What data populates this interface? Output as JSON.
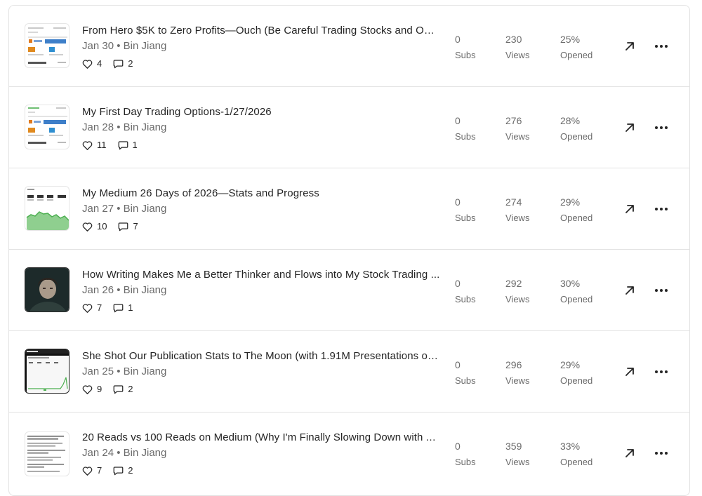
{
  "labels": {
    "subs": "Subs",
    "views": "Views",
    "opened": "Opened",
    "separator": "•"
  },
  "posts": [
    {
      "title": "From Hero $5K to Zero Profits—Ouch (Be Careful Trading Stocks and Opti...",
      "date": "Jan 30",
      "author": "Bin Jiang",
      "likes": "4",
      "comments": "2",
      "subs": "0",
      "views": "230",
      "opened": "25%",
      "thumb": "trading-screenshot"
    },
    {
      "title": "My First Day Trading Options-1/27/2026",
      "date": "Jan 28",
      "author": "Bin Jiang",
      "likes": "11",
      "comments": "1",
      "subs": "0",
      "views": "276",
      "opened": "28%",
      "thumb": "trading-screenshot"
    },
    {
      "title": "My Medium 26 Days of 2026—Stats and Progress",
      "date": "Jan 27",
      "author": "Bin Jiang",
      "likes": "10",
      "comments": "7",
      "subs": "0",
      "views": "274",
      "opened": "29%",
      "thumb": "stats-chart"
    },
    {
      "title": "How Writing Makes Me a Better Thinker and Flows into My Stock Trading ...",
      "date": "Jan 26",
      "author": "Bin Jiang",
      "likes": "7",
      "comments": "1",
      "subs": "0",
      "views": "292",
      "opened": "30%",
      "thumb": "portrait-photo"
    },
    {
      "title": "She Shot Our Publication Stats to The Moon (with 1.91M Presentations on ...",
      "date": "Jan 25",
      "author": "Bin Jiang",
      "likes": "9",
      "comments": "2",
      "subs": "0",
      "views": "296",
      "opened": "29%",
      "thumb": "dark-stats-screenshot"
    },
    {
      "title": "20 Reads vs 100 Reads on Medium (Why I'm Finally Slowing Down with Ab...",
      "date": "Jan 24",
      "author": "Bin Jiang",
      "likes": "7",
      "comments": "2",
      "subs": "0",
      "views": "359",
      "opened": "33%",
      "thumb": "text-document"
    }
  ]
}
